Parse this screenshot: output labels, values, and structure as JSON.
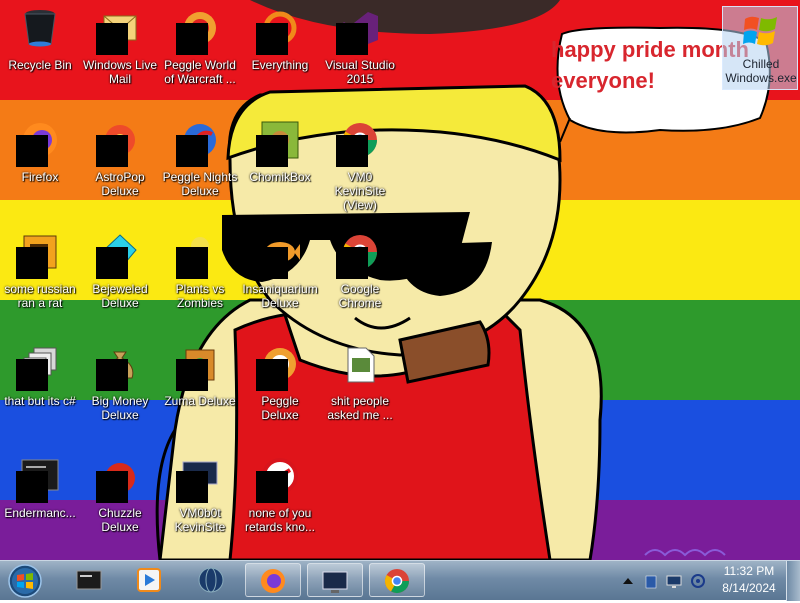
{
  "desktop": {
    "speech_bubble": {
      "line1": "happy pride month",
      "line2": "everyone!"
    },
    "icons": [
      {
        "label": "Recycle Bin",
        "icon": "recycle-bin-icon",
        "redacted": false
      },
      {
        "label": "Windows Live Mail",
        "icon": "mail-icon",
        "redacted": true
      },
      {
        "label": "Peggle World of Warcraft ...",
        "icon": "peggle-icon",
        "redacted": true
      },
      {
        "label": "Everything",
        "icon": "everything-icon",
        "redacted": true
      },
      {
        "label": "Visual Studio 2015",
        "icon": "visual-studio-icon",
        "redacted": true
      },
      {
        "label": "Firefox",
        "icon": "firefox-icon",
        "redacted": true
      },
      {
        "label": "AstroPop Deluxe",
        "icon": "astropop-icon",
        "redacted": true
      },
      {
        "label": "Peggle Nights Deluxe",
        "icon": "peggle-nights-icon",
        "redacted": true
      },
      {
        "label": "ChomikBox",
        "icon": "chomikbox-icon",
        "redacted": true
      },
      {
        "label": "VM0 KevinSite (View)",
        "icon": "chrome-icon",
        "redacted": true
      },
      {
        "label": "some russian ran a rat",
        "icon": "file-icon",
        "redacted": true
      },
      {
        "label": "Bejeweled Deluxe",
        "icon": "bejeweled-icon",
        "redacted": true
      },
      {
        "label": "Plants vs Zombies",
        "icon": "plants-vs-zombies-icon",
        "redacted": true
      },
      {
        "label": "Insaniquarium Deluxe",
        "icon": "insaniquarium-icon",
        "redacted": true
      },
      {
        "label": "Google Chrome",
        "icon": "chrome-icon",
        "redacted": true
      },
      {
        "label": "that but its c#",
        "icon": "folder-stack-icon",
        "redacted": true
      },
      {
        "label": "Big Money Deluxe",
        "icon": "money-bag-icon",
        "redacted": true
      },
      {
        "label": "Zuma Deluxe",
        "icon": "zuma-icon",
        "redacted": true
      },
      {
        "label": "Peggle Deluxe",
        "icon": "peggle-icon",
        "redacted": true
      },
      {
        "label": "shit people asked me ...",
        "icon": "document-icon",
        "redacted": false
      },
      {
        "label": "Endermanc...",
        "icon": "terminal-icon",
        "redacted": true
      },
      {
        "label": "Chuzzle Deluxe",
        "icon": "chuzzle-icon",
        "redacted": true
      },
      {
        "label": "VM0b0t KevinSite",
        "icon": "monitor-icon",
        "redacted": true
      },
      {
        "label": "none of you retards kno...",
        "icon": "opera-icon",
        "redacted": true
      }
    ],
    "selected_icon": {
      "label": "Chilled Windows.exe",
      "icon": "windows-flag-icon"
    }
  },
  "taskbar": {
    "start_icon": "windows-orb-icon",
    "pinned": [
      {
        "name": "terminal",
        "icon": "terminal-icon",
        "open": false
      },
      {
        "name": "media-player",
        "icon": "media-player-icon",
        "open": false
      },
      {
        "name": "globe",
        "icon": "globe-icon",
        "open": false
      },
      {
        "name": "firefox",
        "icon": "firefox-icon",
        "open": true
      },
      {
        "name": "monitor",
        "icon": "monitor-icon",
        "open": true
      },
      {
        "name": "chrome",
        "icon": "chrome-icon",
        "open": true
      }
    ],
    "tray": {
      "icons": [
        "show-hidden-icon",
        "network-icon",
        "display-icon",
        "volume-icon"
      ],
      "time": "11:32 PM",
      "date": "8/14/2024"
    }
  },
  "colors": {
    "red": "#e8141c",
    "orange": "#f47b16",
    "yellow": "#fbe912",
    "green": "#2e9a2c",
    "blue": "#1a4fe0",
    "purple": "#7a1d9a",
    "bubble_text": "#d8262e"
  }
}
